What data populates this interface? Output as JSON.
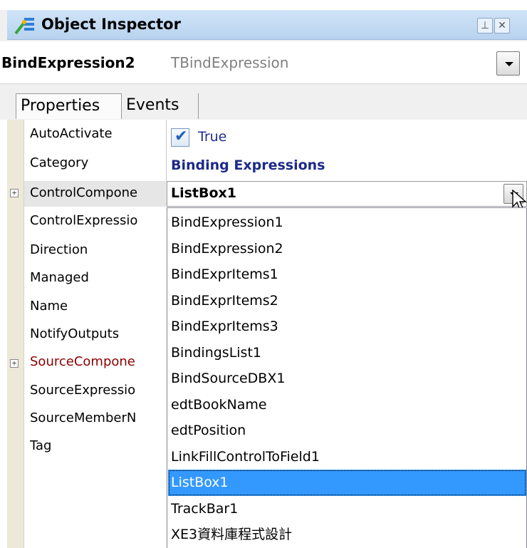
{
  "window": {
    "title": "Object Inspector",
    "icon": "object-inspector-icon",
    "pin_button": "pin-icon",
    "close_button": "close-icon"
  },
  "component_selector": {
    "name": "BindExpression2",
    "type": "TBindExpression"
  },
  "tabs": [
    {
      "label": "Properties",
      "active": true
    },
    {
      "label": "Events",
      "active": false
    }
  ],
  "properties": [
    {
      "name": "AutoActivate"
    },
    {
      "name": "Category"
    },
    {
      "name": "ControlCompone",
      "expandable": true
    },
    {
      "name": "ControlExpressio"
    },
    {
      "name": "Direction"
    },
    {
      "name": "Managed"
    },
    {
      "name": "Name"
    },
    {
      "name": "NotifyOutputs"
    },
    {
      "name": "SourceCompone",
      "expandable": true,
      "color": "#8b0000"
    },
    {
      "name": "SourceExpressio"
    },
    {
      "name": "SourceMemberN"
    },
    {
      "name": "Tag"
    }
  ],
  "values": {
    "autoactivate": {
      "checked": true,
      "text": "True"
    },
    "category": "Binding Expressions",
    "control_component": "ListBox1"
  },
  "dropdown": {
    "items": [
      "BindExpression1",
      "BindExpression2",
      "BindExprItems1",
      "BindExprItems2",
      "BindExprItems3",
      "BindingsList1",
      "BindSourceDBX1",
      "edtBookName",
      "edtPosition",
      "LinkFillControlToField1",
      "ListBox1",
      "TrackBar1",
      "XE3資料庫程式設計"
    ],
    "selected": "ListBox1"
  },
  "colors": {
    "selection": "#3399ff",
    "value_text": "#1c2a8a",
    "required_property": "#8b0000"
  }
}
